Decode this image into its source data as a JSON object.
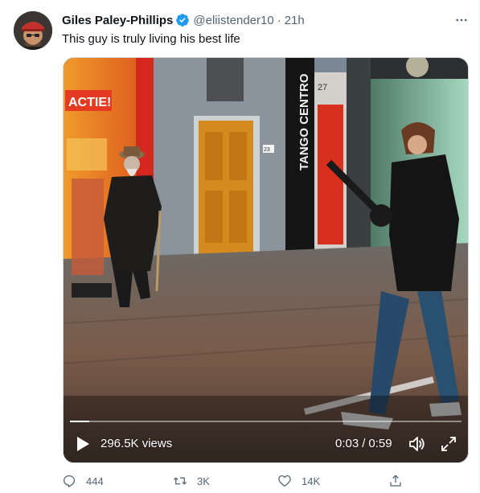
{
  "tweet": {
    "display_name": "Giles Paley-Phillips",
    "verified": true,
    "handle": "@eliistender10",
    "separator": "·",
    "time": "21h",
    "text": "This guy is truly living his best life",
    "more_icon": "more-horizontal-icon"
  },
  "video": {
    "views": "296.5K views",
    "current_time": "0:03",
    "time_separator": "/",
    "duration": "0:59",
    "progress": 0.05,
    "signs": {
      "shop_sign": "ACTIE!",
      "vertical_sign": "TANGO CENTRO",
      "door_number": "27",
      "wall_number": "23"
    },
    "icons": {
      "play": "play-icon",
      "volume": "volume-icon",
      "fullscreen": "fullscreen-icon"
    }
  },
  "actions": {
    "reply_count": "444",
    "retweet_count": "3K",
    "like_count": "14K",
    "icons": [
      "reply-icon",
      "retweet-icon",
      "like-icon",
      "share-icon"
    ]
  },
  "colors": {
    "verified_blue": "#1d9bf0",
    "text_primary": "#0f1419",
    "text_secondary": "#536471",
    "border": "#cfd9de"
  }
}
